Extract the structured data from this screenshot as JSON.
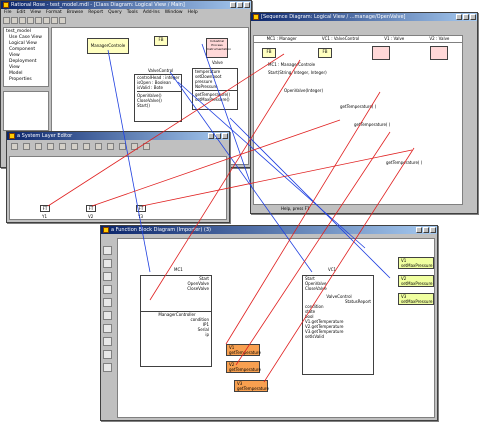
{
  "rose_window": {
    "title": "Rational Rose - test_model.mdl - [Class Diagram: Logical View / Main]",
    "menu": [
      "File",
      "Edit",
      "View",
      "Format",
      "Browse",
      "Report",
      "Query",
      "Tools",
      "Add-Ins",
      "Window",
      "Help"
    ],
    "tree": [
      "test_model",
      "Use Case View",
      "Logical View",
      "Component View",
      "Deployment View",
      "Model Properties"
    ],
    "classes": {
      "manager": "ManagerControle",
      "valve": "Valve",
      "fb_label": "FB",
      "fb_sub": "Industrial Process Instrumentation",
      "class_name": "ValveControl",
      "attributes": [
        "controlHead : integer",
        "isOpen : Boolean",
        "isValid : Bote"
      ],
      "ops": [
        "OpenValve()",
        "CloseValve()",
        "Start()"
      ],
      "valve_attrs": [
        "temperature",
        "setDownboot",
        "pressure",
        "NoPressure"
      ],
      "valve_ops": [
        "getTemperature()",
        "setMaxPressure()"
      ]
    }
  },
  "sequence_window": {
    "title": "[Sequence Diagram: Logical View / ...manage/OpenValve]",
    "lifelines": [
      "MC1 : Manager",
      "VC1 : ValveControl",
      "V1 : Valve",
      "V2 : Valve"
    ],
    "messages": [
      "Start(String, Integer, Integer)",
      "OpenValve(Integer)",
      "getTemperature( )",
      "getTemperature( )",
      "getTemperature( )"
    ],
    "actor_label": "MC1 : ManagerControle",
    "status": "Help, press F1"
  },
  "layer_window": {
    "title": "a System Layer Editor",
    "instances": [
      {
        "tag": "FT",
        "name": "Y1"
      },
      {
        "tag": "FT",
        "name": "V2"
      },
      {
        "tag": "FT",
        "name": "Y3"
      }
    ]
  },
  "fb_window": {
    "title": "a Function Block Diagram (Importer) (3)",
    "mc1": {
      "name": "MC1",
      "ports_out": [
        "Start",
        "OpenValve",
        "CloseValve"
      ],
      "type": "ManagerController",
      "inputs": [
        "condition",
        "IP1",
        "Serial",
        "ip"
      ]
    },
    "vc1": {
      "name": "VC1",
      "ports_in": [
        "Start",
        "OpenValve",
        "CloseValve"
      ],
      "type": "ValveControl",
      "right": "StatusReport",
      "inputs": [
        "condition",
        "state",
        "bool",
        "V1.getTemperature",
        "V2.getTemperature",
        "V3.getTemperature",
        "setIsValid"
      ]
    },
    "orange_boxes": [
      {
        "tag": "V1",
        "label": "getTemperature"
      },
      {
        "tag": "V2",
        "label": "getTemperature"
      },
      {
        "tag": "V3",
        "label": "getTemperature"
      }
    ],
    "green_boxes": [
      {
        "tag": "V1",
        "label": "setMaxPressure"
      },
      {
        "tag": "V2",
        "label": "setMaxPressure"
      },
      {
        "tag": "V3",
        "label": "setMaxPressure"
      }
    ]
  },
  "colors": {
    "title_start": "#0a246a",
    "arrow_blue": "#2040e0",
    "arrow_red": "#e02020",
    "orange_box": "#f8a050",
    "green_box": "#f0ffa0"
  }
}
